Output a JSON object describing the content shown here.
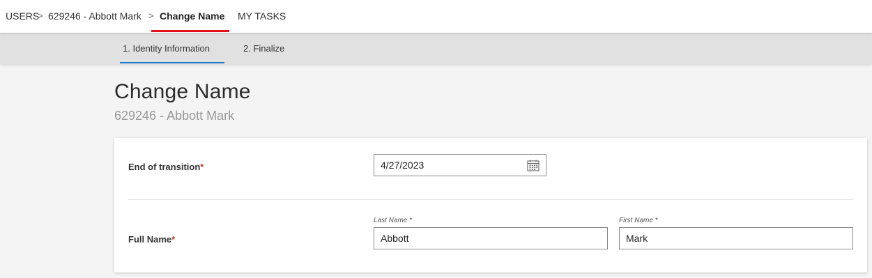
{
  "breadcrumb": {
    "items": [
      "USERS",
      "629246 - Abbott Mark",
      "Change Name",
      "MY TASKS"
    ],
    "separator": ">"
  },
  "steps": [
    "1. Identity Information",
    "2. Finalize"
  ],
  "page": {
    "title": "Change Name",
    "subtitle": "629246 - Abbott Mark"
  },
  "form": {
    "end_of_transition": {
      "label": "End of transition",
      "required_mark": "*",
      "value": "4/27/2023",
      "icon": "calendar-icon"
    },
    "full_name": {
      "label": "Full Name",
      "required_mark": "*",
      "last_name_label": "Last Name *",
      "last_name_value": "Abbott",
      "first_name_label": "First Name *",
      "first_name_value": "Mark"
    }
  },
  "colors": {
    "active_tab_underline": "#e4121b",
    "active_step_underline": "#1e78c8",
    "required_asterisk": "#c0392b"
  }
}
